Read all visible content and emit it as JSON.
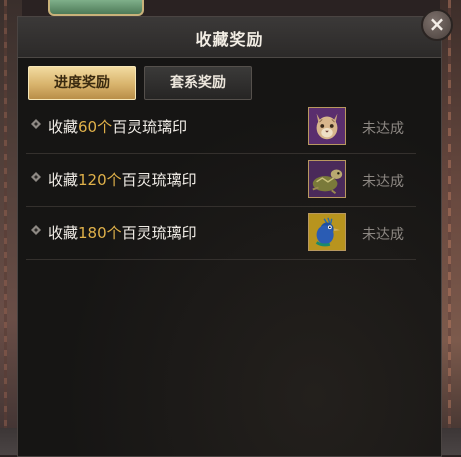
{
  "window": {
    "title": "收藏奖励",
    "close_label": "×"
  },
  "tabs": [
    {
      "label": "进度奖励",
      "active": true
    },
    {
      "label": "套系奖励",
      "active": false
    }
  ],
  "rewards": [
    {
      "prefix": "收藏",
      "count": "60个",
      "suffix": "百灵琉璃印",
      "icon": "lynx-icon",
      "status": "未达成"
    },
    {
      "prefix": "收藏",
      "count": "120个",
      "suffix": "百灵琉璃印",
      "icon": "turtle-icon",
      "status": "未达成"
    },
    {
      "prefix": "收藏",
      "count": "180个",
      "suffix": "百灵琉璃印",
      "icon": "peacock-icon",
      "status": "未达成"
    }
  ],
  "colors": {
    "accent_gold": "#e0b14a",
    "status_gray": "#8c8782"
  }
}
